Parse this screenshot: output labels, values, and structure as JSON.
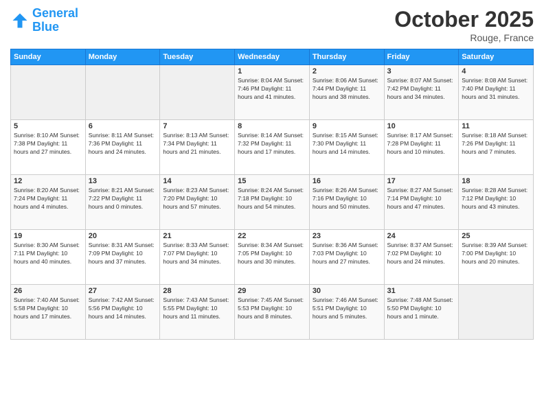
{
  "logo": {
    "line1": "General",
    "line2": "Blue"
  },
  "header": {
    "title": "October 2025",
    "location": "Rouge, France"
  },
  "days_of_week": [
    "Sunday",
    "Monday",
    "Tuesday",
    "Wednesday",
    "Thursday",
    "Friday",
    "Saturday"
  ],
  "weeks": [
    [
      {
        "day": "",
        "info": ""
      },
      {
        "day": "",
        "info": ""
      },
      {
        "day": "",
        "info": ""
      },
      {
        "day": "1",
        "info": "Sunrise: 8:04 AM\nSunset: 7:46 PM\nDaylight: 11 hours\nand 41 minutes."
      },
      {
        "day": "2",
        "info": "Sunrise: 8:06 AM\nSunset: 7:44 PM\nDaylight: 11 hours\nand 38 minutes."
      },
      {
        "day": "3",
        "info": "Sunrise: 8:07 AM\nSunset: 7:42 PM\nDaylight: 11 hours\nand 34 minutes."
      },
      {
        "day": "4",
        "info": "Sunrise: 8:08 AM\nSunset: 7:40 PM\nDaylight: 11 hours\nand 31 minutes."
      }
    ],
    [
      {
        "day": "5",
        "info": "Sunrise: 8:10 AM\nSunset: 7:38 PM\nDaylight: 11 hours\nand 27 minutes."
      },
      {
        "day": "6",
        "info": "Sunrise: 8:11 AM\nSunset: 7:36 PM\nDaylight: 11 hours\nand 24 minutes."
      },
      {
        "day": "7",
        "info": "Sunrise: 8:13 AM\nSunset: 7:34 PM\nDaylight: 11 hours\nand 21 minutes."
      },
      {
        "day": "8",
        "info": "Sunrise: 8:14 AM\nSunset: 7:32 PM\nDaylight: 11 hours\nand 17 minutes."
      },
      {
        "day": "9",
        "info": "Sunrise: 8:15 AM\nSunset: 7:30 PM\nDaylight: 11 hours\nand 14 minutes."
      },
      {
        "day": "10",
        "info": "Sunrise: 8:17 AM\nSunset: 7:28 PM\nDaylight: 11 hours\nand 10 minutes."
      },
      {
        "day": "11",
        "info": "Sunrise: 8:18 AM\nSunset: 7:26 PM\nDaylight: 11 hours\nand 7 minutes."
      }
    ],
    [
      {
        "day": "12",
        "info": "Sunrise: 8:20 AM\nSunset: 7:24 PM\nDaylight: 11 hours\nand 4 minutes."
      },
      {
        "day": "13",
        "info": "Sunrise: 8:21 AM\nSunset: 7:22 PM\nDaylight: 11 hours\nand 0 minutes."
      },
      {
        "day": "14",
        "info": "Sunrise: 8:23 AM\nSunset: 7:20 PM\nDaylight: 10 hours\nand 57 minutes."
      },
      {
        "day": "15",
        "info": "Sunrise: 8:24 AM\nSunset: 7:18 PM\nDaylight: 10 hours\nand 54 minutes."
      },
      {
        "day": "16",
        "info": "Sunrise: 8:26 AM\nSunset: 7:16 PM\nDaylight: 10 hours\nand 50 minutes."
      },
      {
        "day": "17",
        "info": "Sunrise: 8:27 AM\nSunset: 7:14 PM\nDaylight: 10 hours\nand 47 minutes."
      },
      {
        "day": "18",
        "info": "Sunrise: 8:28 AM\nSunset: 7:12 PM\nDaylight: 10 hours\nand 43 minutes."
      }
    ],
    [
      {
        "day": "19",
        "info": "Sunrise: 8:30 AM\nSunset: 7:11 PM\nDaylight: 10 hours\nand 40 minutes."
      },
      {
        "day": "20",
        "info": "Sunrise: 8:31 AM\nSunset: 7:09 PM\nDaylight: 10 hours\nand 37 minutes."
      },
      {
        "day": "21",
        "info": "Sunrise: 8:33 AM\nSunset: 7:07 PM\nDaylight: 10 hours\nand 34 minutes."
      },
      {
        "day": "22",
        "info": "Sunrise: 8:34 AM\nSunset: 7:05 PM\nDaylight: 10 hours\nand 30 minutes."
      },
      {
        "day": "23",
        "info": "Sunrise: 8:36 AM\nSunset: 7:03 PM\nDaylight: 10 hours\nand 27 minutes."
      },
      {
        "day": "24",
        "info": "Sunrise: 8:37 AM\nSunset: 7:02 PM\nDaylight: 10 hours\nand 24 minutes."
      },
      {
        "day": "25",
        "info": "Sunrise: 8:39 AM\nSunset: 7:00 PM\nDaylight: 10 hours\nand 20 minutes."
      }
    ],
    [
      {
        "day": "26",
        "info": "Sunrise: 7:40 AM\nSunset: 5:58 PM\nDaylight: 10 hours\nand 17 minutes."
      },
      {
        "day": "27",
        "info": "Sunrise: 7:42 AM\nSunset: 5:56 PM\nDaylight: 10 hours\nand 14 minutes."
      },
      {
        "day": "28",
        "info": "Sunrise: 7:43 AM\nSunset: 5:55 PM\nDaylight: 10 hours\nand 11 minutes."
      },
      {
        "day": "29",
        "info": "Sunrise: 7:45 AM\nSunset: 5:53 PM\nDaylight: 10 hours\nand 8 minutes."
      },
      {
        "day": "30",
        "info": "Sunrise: 7:46 AM\nSunset: 5:51 PM\nDaylight: 10 hours\nand 5 minutes."
      },
      {
        "day": "31",
        "info": "Sunrise: 7:48 AM\nSunset: 5:50 PM\nDaylight: 10 hours\nand 1 minute."
      },
      {
        "day": "",
        "info": ""
      }
    ]
  ]
}
